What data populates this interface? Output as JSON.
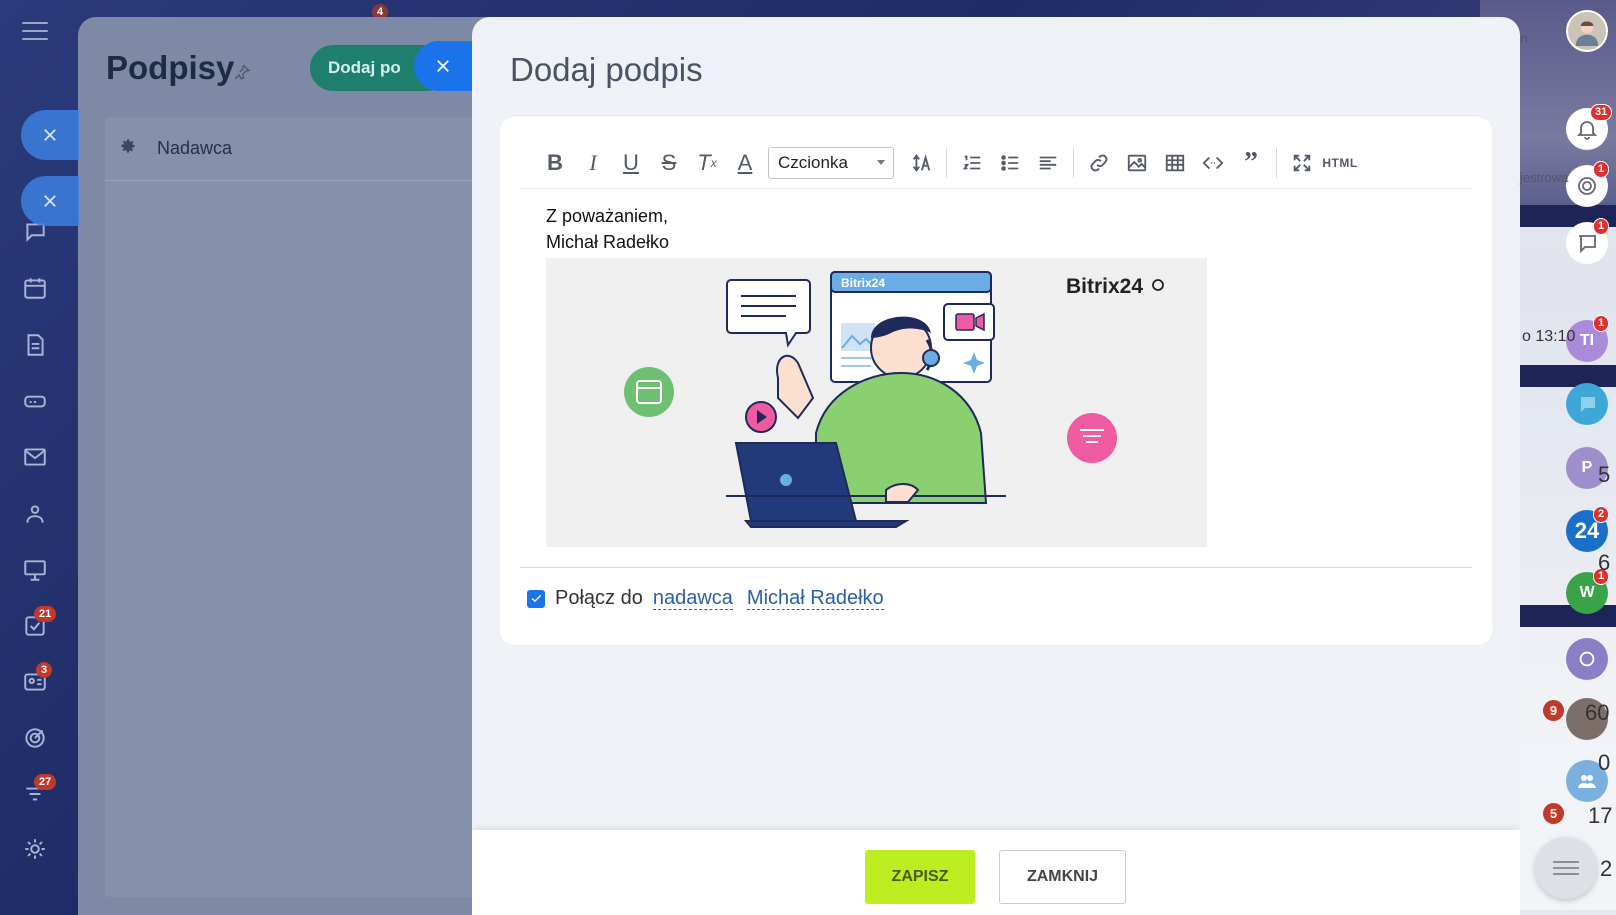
{
  "back_panel": {
    "title": "Podpisy",
    "add_button": "Dodaj po",
    "row_label": "Nadawca",
    "top_badge": "4"
  },
  "slider": {
    "title": "Dodaj podpis",
    "font_select": "Czcionka",
    "html_button": "HTML",
    "signature_line1": "Z poważaniem,",
    "signature_line2": "Michał Radełko",
    "banner_brand": "Bitrix24",
    "banner_window_label": "Bitrix24",
    "connect_label": "Połącz do",
    "connect_link_sender": "nadawca",
    "connect_link_name": "Michał Radełko",
    "connect_checked": true
  },
  "footer": {
    "save": "ZAPISZ",
    "close": "ZAMKNIJ"
  },
  "left_nav": {
    "tasks_badge": "21",
    "contacts_badge": "3",
    "feed_badge": "27"
  },
  "right_col": {
    "notifications_badge": "31",
    "badge_2": "1",
    "badge_3": "1",
    "avatar_ti": "TI",
    "badge_ti": "1",
    "avatar_p": "P",
    "avatar_24": "24",
    "badge_24": "2",
    "avatar_w": "W",
    "badge_w": "1",
    "fragment_time": "o 13:10",
    "fragment_reg": "jestrowa",
    "fragment_n": "n",
    "fragment_5": "5",
    "fragment_6": "6",
    "fragment_60": "60",
    "fragment_0": "0",
    "fragment_17": "17",
    "fragment_2": "2",
    "side_badge_9": "9",
    "side_badge_5": "5"
  },
  "colors": {
    "accent_blue": "#1a73e8",
    "save_green": "#bbed21",
    "add_button_teal": "#1f7f6f"
  }
}
